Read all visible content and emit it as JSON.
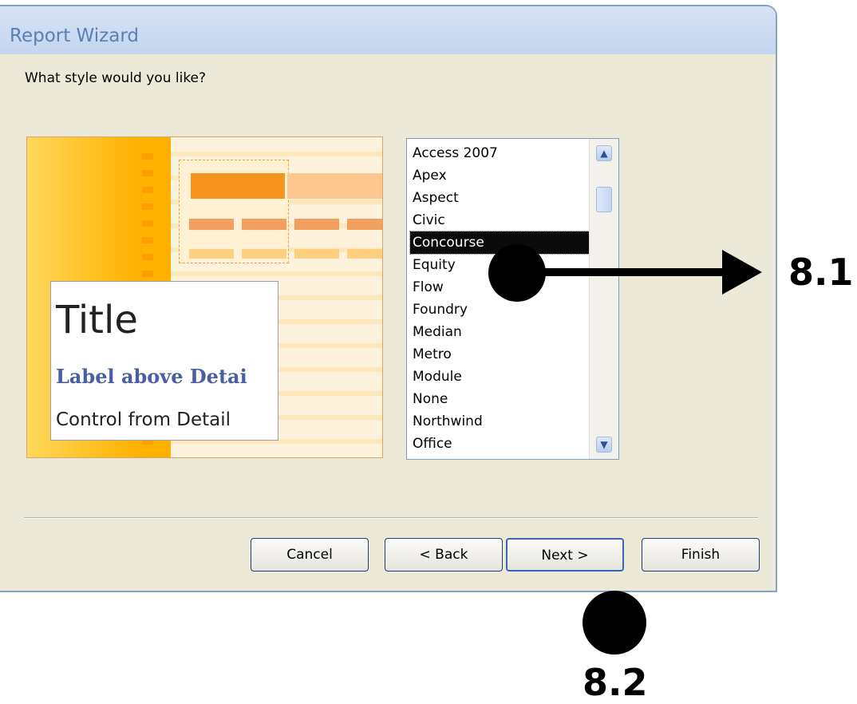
{
  "window": {
    "title": "Report Wizard"
  },
  "question": "What style would you like?",
  "preview": {
    "title": "Title",
    "label": "Label above Detai",
    "control": "Control from Detail"
  },
  "styles": {
    "items": [
      "Access 2007",
      "Apex",
      "Aspect",
      "Civic",
      "Concourse",
      "Equity",
      "Flow",
      "Foundry",
      "Median",
      "Metro",
      "Module",
      "None",
      "Northwind",
      "Office"
    ],
    "selected": "Concourse"
  },
  "buttons": {
    "cancel": "Cancel",
    "back": "< Back",
    "next": "Next >",
    "finish": "Finish"
  },
  "annotations": {
    "step1": "8.1",
    "step2": "8.2"
  }
}
